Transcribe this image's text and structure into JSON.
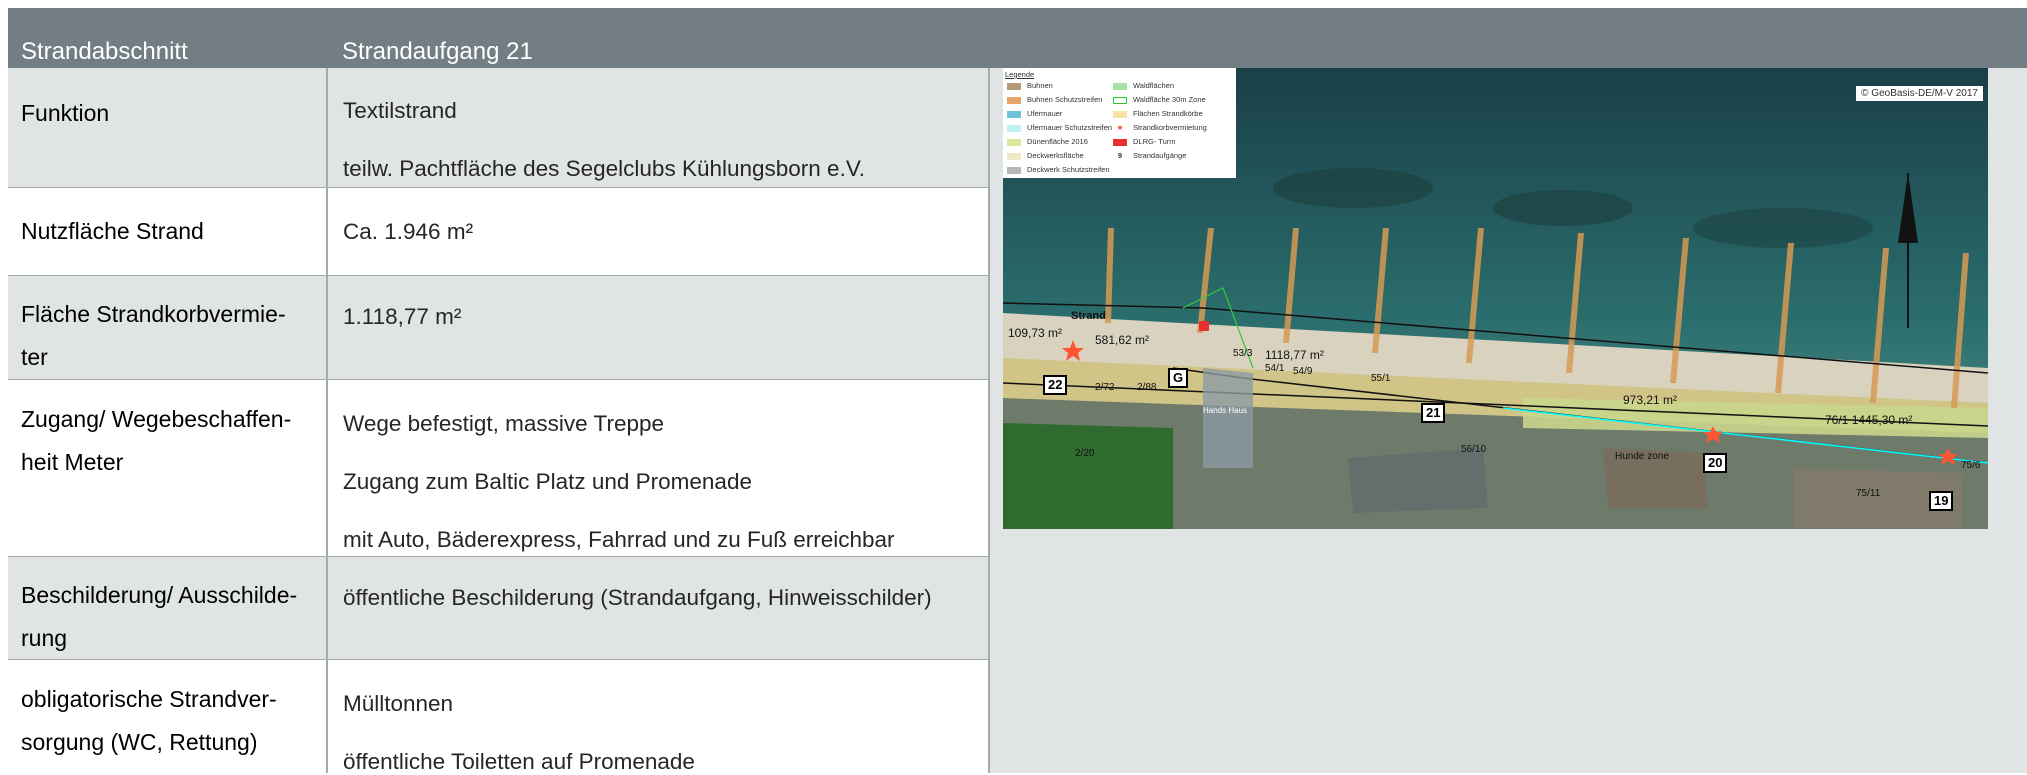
{
  "header": {
    "col1": "Strandabschnitt",
    "col2": "Strandaufgang 21"
  },
  "rows": [
    {
      "label": "Funktion",
      "values": [
        "Textilstrand",
        "teilw. Pachtfläche des Segelclubs Kühlungsborn e.V."
      ]
    },
    {
      "label": "Nutzfläche Strand",
      "values": [
        "Ca. 1.946 m²"
      ]
    },
    {
      "label": "Fläche Strandkorbvermie-ter",
      "values": [
        "1.118,77 m²"
      ]
    },
    {
      "label": "Zugang/ Wegebeschaffen-heit Meter",
      "values": [
        "Wege befestigt, massive Treppe",
        "Zugang zum Baltic Platz und Promenade",
        "mit Auto, Bäderexpress, Fahrrad und zu Fuß erreichbar"
      ]
    },
    {
      "label": "Beschilderung/ Ausschilde-rung",
      "values": [
        "öffentliche Beschilderung (Strandaufgang, Hinweisschilder)"
      ]
    },
    {
      "label": "obligatorische Strandver-sorgung (WC, Rettung)",
      "values": [
        "Mülltonnen",
        "öffentliche Toiletten auf Promenade"
      ]
    }
  ],
  "map": {
    "copyright": "© GeoBasis-DE/M-V 2017",
    "legend_title": "Legende",
    "legend_left": [
      "Buhnen",
      "Buhnen Schutzstreifen",
      "Ufermauer",
      "Ufermauer Schutzstreifen",
      "Dünenfläche 2016",
      "Deckwerksfläche",
      "Deckwerk Schutzstreifen"
    ],
    "legend_right": [
      "Waldflächen",
      "Waldfläche 30m Zone",
      "Flächen Strandkörbe",
      "Strandkorbvermietung",
      "DLRG- Turm",
      "Strandaufgänge"
    ],
    "legend_right_nine": "9",
    "legend_left_colors": [
      "#b59a76",
      "#e6a36b",
      "#6fc3d6",
      "#bff0f5",
      "#d9e89c",
      "#efe9c9",
      "#b7b7b7"
    ],
    "legend_right_colors": [
      "#a7e3a0",
      "#ffffff",
      "#f7e3a8"
    ],
    "labels": {
      "strand": "Strand",
      "a1": "109,73 m²",
      "a2": "581,62 m²",
      "a3": "1118,77 m²",
      "a4": "973,21 m²",
      "a5": "76/1 1445,30 m²",
      "p1": "53/3",
      "p2": "54/1",
      "p3": "54/9",
      "p4": "55/1",
      "p5": "56/10",
      "p6": "2/72",
      "p7": "2/20",
      "p8": "2/88",
      "p9": "75/11",
      "p10": "75/6",
      "hh": "Hands Haus",
      "zone": "Hunde zone"
    },
    "boxes": {
      "b22": "22",
      "bG": "G",
      "b21": "21",
      "b20": "20",
      "b19": "19"
    }
  }
}
